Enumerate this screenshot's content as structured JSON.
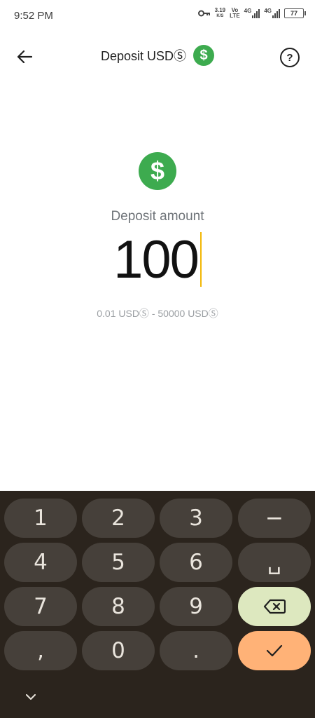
{
  "status_bar": {
    "time": "9:52 PM",
    "speed_value": "3.19",
    "speed_unit": "K/S",
    "volte_top": "Vo",
    "volte_bottom": "LTE",
    "net1": "4G",
    "net2": "4G",
    "battery": "77",
    "icons": [
      "key-icon",
      "signal-icon",
      "battery-icon"
    ]
  },
  "appbar": {
    "title": "Deposit USDⓈ",
    "coin_symbol": "$",
    "help_symbol": "?"
  },
  "main": {
    "coin_symbol": "$",
    "amount_label": "Deposit amount",
    "amount_value": "100",
    "range_text": "0.01 USDⓈ - 50000 USDⓈ"
  },
  "keyboard": {
    "keys": {
      "k1": "1",
      "k2": "2",
      "k3": "3",
      "minus": "−",
      "k4": "4",
      "k5": "5",
      "k6": "6",
      "space": "␣",
      "k7": "7",
      "k8": "8",
      "k9": "9",
      "comma": ",",
      "k0": "0",
      "dot": "."
    },
    "colors": {
      "background": "#2b241d",
      "key": "#46403a",
      "delete": "#dde8bf",
      "enter": "#ffb277"
    }
  },
  "colors": {
    "coin_green": "#3dab4f",
    "cursor": "#f2b705"
  }
}
